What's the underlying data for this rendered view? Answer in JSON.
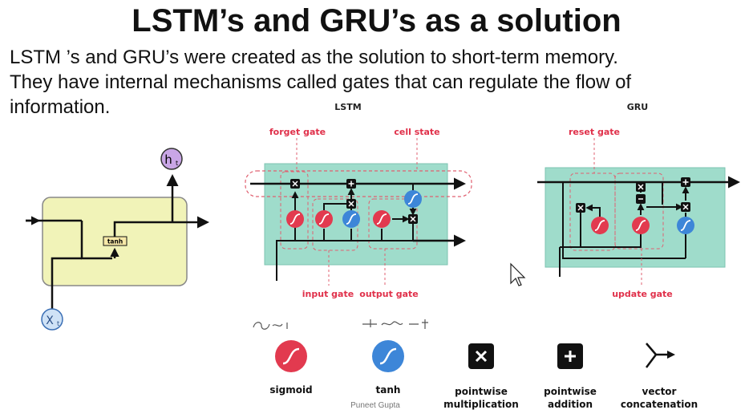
{
  "slide": {
    "title": "LSTM’s and GRU’s as a solution",
    "body_lines": [
      "LSTM ’s and GRU’s were created as the solution to short-term memory.",
      "They have internal mechanisms called gates that can regulate the flow of",
      "information."
    ]
  },
  "rnn_cell": {
    "output_label": "h",
    "output_subscript": "t",
    "input_label": "X",
    "input_subscript": "t",
    "activation_label": "tanh",
    "cell_color": "#f1f3b8",
    "node_color": "#c9a6e6"
  },
  "lstm": {
    "heading": "LSTM",
    "labels": {
      "forget_gate": "forget gate",
      "cell_state": "cell state",
      "input_gate": "input gate",
      "output_gate": "output gate"
    },
    "box_color": "#9fdccb"
  },
  "gru": {
    "heading": "GRU",
    "labels": {
      "reset_gate": "reset gate",
      "update_gate": "update gate"
    },
    "box_color": "#9fdccb"
  },
  "legend": [
    {
      "icon": "sigmoid-icon",
      "label_lines": [
        "sigmoid"
      ]
    },
    {
      "icon": "tanh-icon",
      "label_lines": [
        "tanh"
      ]
    },
    {
      "icon": "multiply-icon",
      "label_lines": [
        "pointwise",
        "multiplication"
      ]
    },
    {
      "icon": "add-icon",
      "label_lines": [
        "pointwise",
        "addition"
      ]
    },
    {
      "icon": "concat-icon",
      "label_lines": [
        "vector",
        "concatenation"
      ]
    }
  ],
  "author": "Puneet Gupta",
  "colors": {
    "gate_label": "#e0304a",
    "sigmoid": "#e23a4f",
    "tanh": "#3d86d8",
    "op_box": "#111111"
  }
}
